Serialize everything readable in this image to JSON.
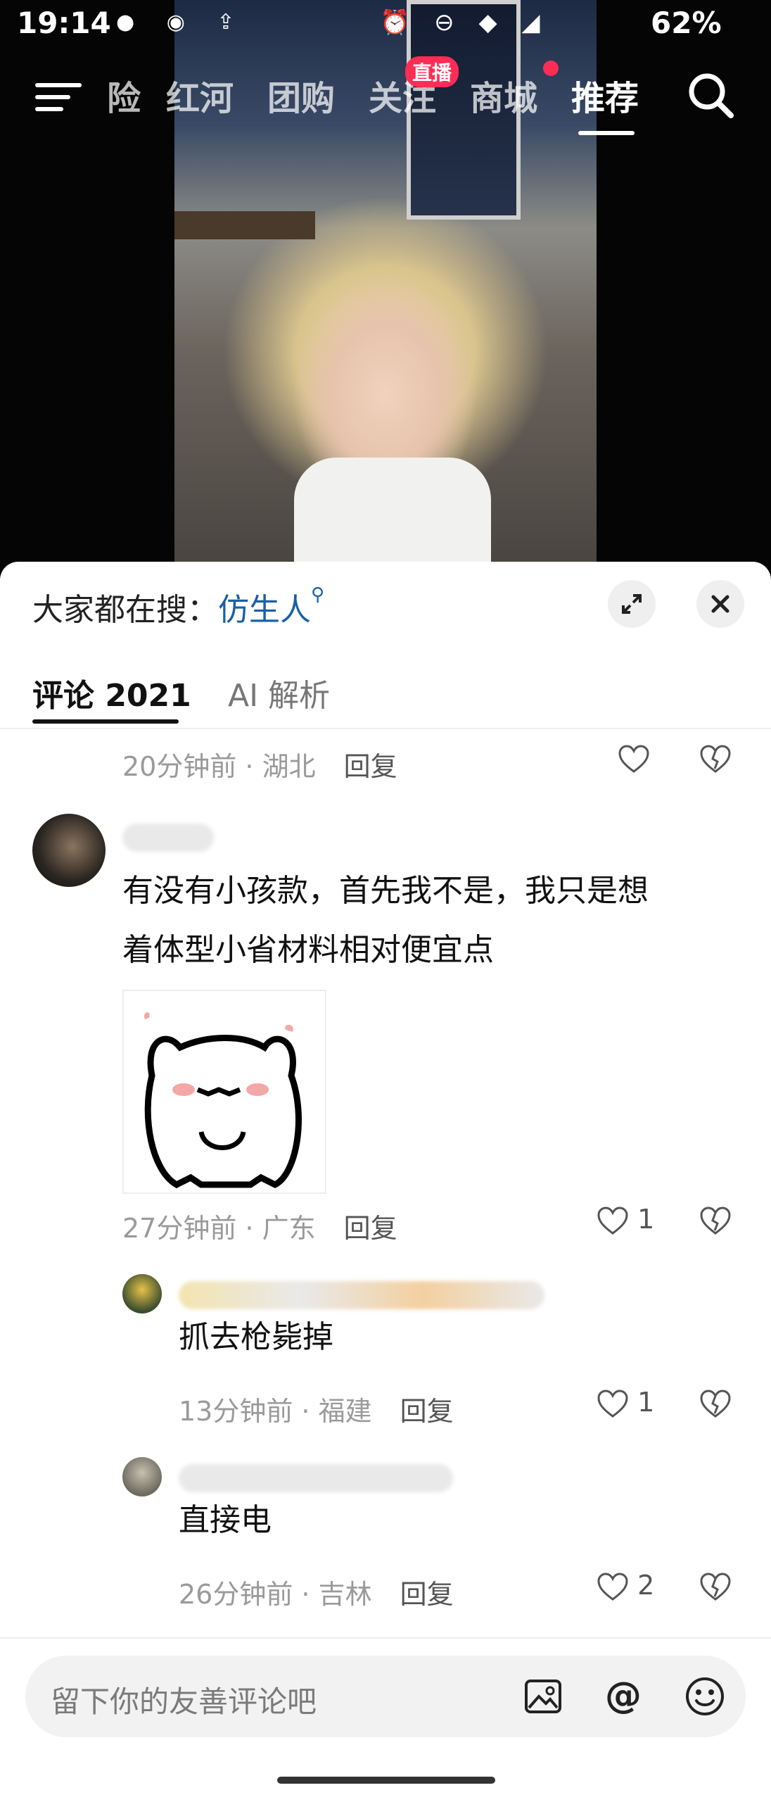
{
  "status_bar": {
    "time": "19:14",
    "battery": "62%",
    "left_icons": "● ◉ ⇪",
    "right_icons": "⏰ ⊖ ◆ ◢"
  },
  "top_nav": {
    "tabs": [
      "险",
      "红河",
      "团购",
      "关注",
      "商城",
      "推荐"
    ],
    "active_tab": "推荐",
    "live_badge": "直播"
  },
  "sheet": {
    "hot_search_label": "大家都在搜：",
    "hot_search_keyword": "仿生人",
    "tabs": {
      "comments": "评论 2021",
      "ai": "AI 解析"
    }
  },
  "comments": [
    {
      "meta": "20分钟前 · 湖北",
      "reply": "回复",
      "likes": ""
    },
    {
      "text_line1": "有没有小孩款，首先我不是，我只是想",
      "text_line2": "着体型小省材料相对便宜点",
      "meta": "27分钟前 · 广东",
      "reply": "回复",
      "likes": "1"
    },
    {
      "text": "抓去枪毙掉",
      "meta": "13分钟前 · 福建",
      "reply": "回复",
      "likes": "1"
    },
    {
      "text": "直接电",
      "meta": "26分钟前 · 吉林",
      "reply": "回复",
      "likes": "2"
    }
  ],
  "input": {
    "placeholder": "留下你的友善评论吧"
  },
  "icons": {
    "menu": "menu-icon",
    "search": "search-icon",
    "expand": "expand-icon",
    "close": "close-icon",
    "heart": "heart-icon",
    "dislike": "broken-heart-icon",
    "image": "image-icon",
    "mention": "at-icon",
    "emoji": "emoji-icon"
  },
  "colors": {
    "accent_live": "#ff2d55",
    "keyword_blue": "#1a5fa8"
  }
}
